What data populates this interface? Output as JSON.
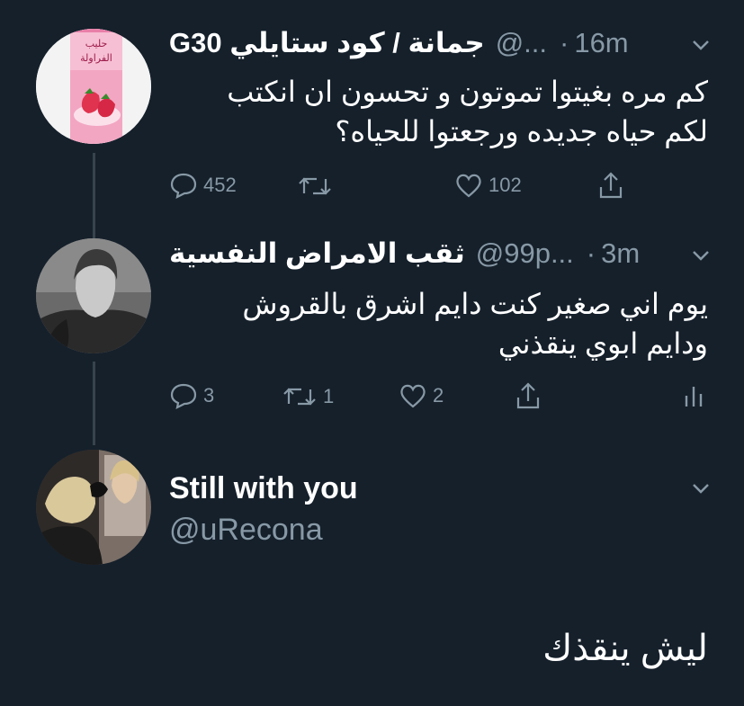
{
  "tweets": [
    {
      "name": "جمانة / كود ستايلي G30",
      "handle": "@...",
      "time": "16m",
      "lines": [
        "كم مره بغيتوا تموتون و تحسون ان انكتب",
        "لكم حياه جديده ورجعتوا للحياه؟"
      ],
      "replies": "452",
      "retweets": "",
      "likes": "102",
      "avatar": {
        "label_top": "حليب",
        "label_bottom": "الفراولة"
      }
    },
    {
      "name": "ثقب الامراض النفسية",
      "handle": "@99p...",
      "time": "3m",
      "lines": [
        "يوم اني صغير كنت دايم اشرق بالقروش",
        "ودايم ابوي ينقذني"
      ],
      "replies": "3",
      "retweets": "1",
      "likes": "2"
    }
  ],
  "current": {
    "name": "Still with you",
    "handle": "@uRecona",
    "text": "ليش ينقذك"
  },
  "colors": {
    "background": "#15202b",
    "muted": "#8899a6",
    "line": "#38444d",
    "text": "#ffffff"
  }
}
